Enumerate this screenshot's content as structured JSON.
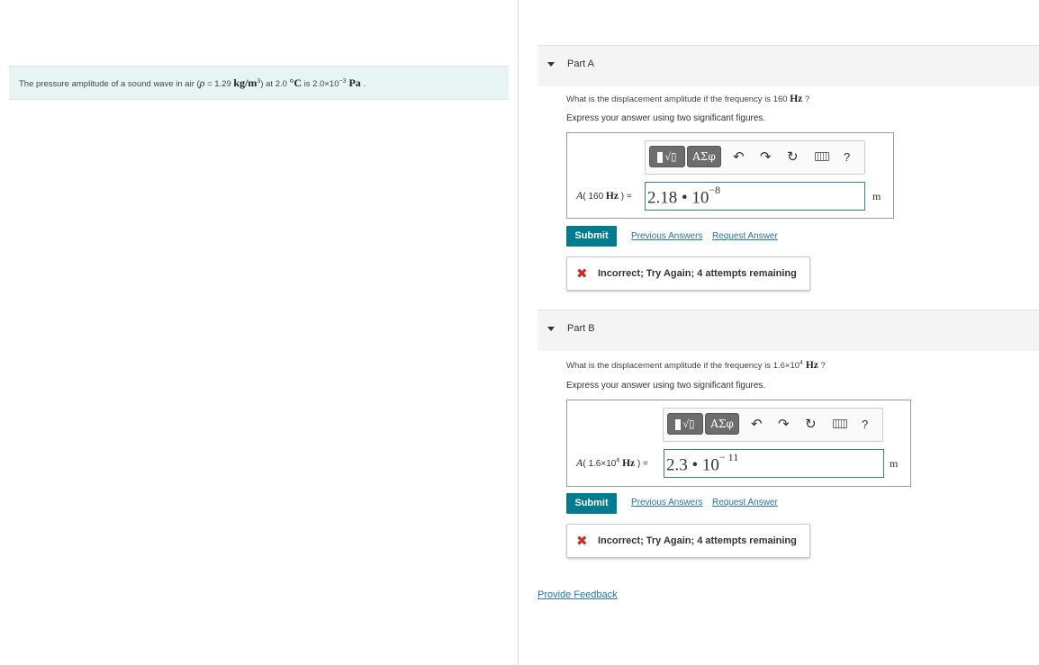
{
  "problem": {
    "pre": "The pressure amplitude of a sound wave in air (",
    "rho": "ρ",
    "eq_value": " = 1.29 ",
    "density_unit": "kg/m",
    "density_exp": "3",
    "mid": ") at 2.0 ",
    "temp_unit": "°C",
    "is_value": " is 2.0×10",
    "amp_exp": "−3",
    "pressure_unit": " Pa",
    "end": " ."
  },
  "parts": [
    {
      "title": "Part A",
      "question_pre": "What is the displacement amplitude if the frequency is 160 ",
      "question_unit": "Hz",
      "question_post": " ?",
      "instruction": "Express your answer using two significant figures.",
      "lhs_var": "A",
      "lhs_open": "( 160 ",
      "lhs_unit": "Hz",
      "lhs_close": " ) =",
      "answer_base": "2.18 • 10",
      "answer_exp": "−8",
      "unit": "m",
      "submit": "Submit",
      "previous": "Previous Answers",
      "request": "Request Answer",
      "feedback": "Incorrect; Try Again; 4 attempts remaining"
    },
    {
      "title": "Part B",
      "question_pre": "What is the displacement amplitude if the frequency is 1.6×10",
      "question_exp": "4",
      "question_unit": " Hz",
      "question_post": " ?",
      "instruction": "Express your answer using two significant figures.",
      "lhs_var": "A",
      "lhs_open": "( 1.6×10",
      "lhs_exp": "4",
      "lhs_unit": " Hz",
      "lhs_close": " ) =",
      "answer_base": "2.3 • 10",
      "answer_exp": "− 11",
      "unit": "m",
      "submit": "Submit",
      "previous": "Previous Answers",
      "request": "Request Answer",
      "feedback": "Incorrect; Try Again; 4 attempts remaining"
    }
  ],
  "toolbar": {
    "greek_label": "ΑΣφ",
    "undo_icon": "undo-icon",
    "redo_icon": "redo-icon",
    "reset_icon": "reset-icon",
    "keyboard_icon": "keyboard-icon",
    "help": "?"
  },
  "footer": {
    "provide_feedback": "Provide Feedback"
  },
  "colors": {
    "submit": "#007c91",
    "link": "#2275a8",
    "incorrect": "#d02b27",
    "problem_bg": "#e8f4f4"
  }
}
